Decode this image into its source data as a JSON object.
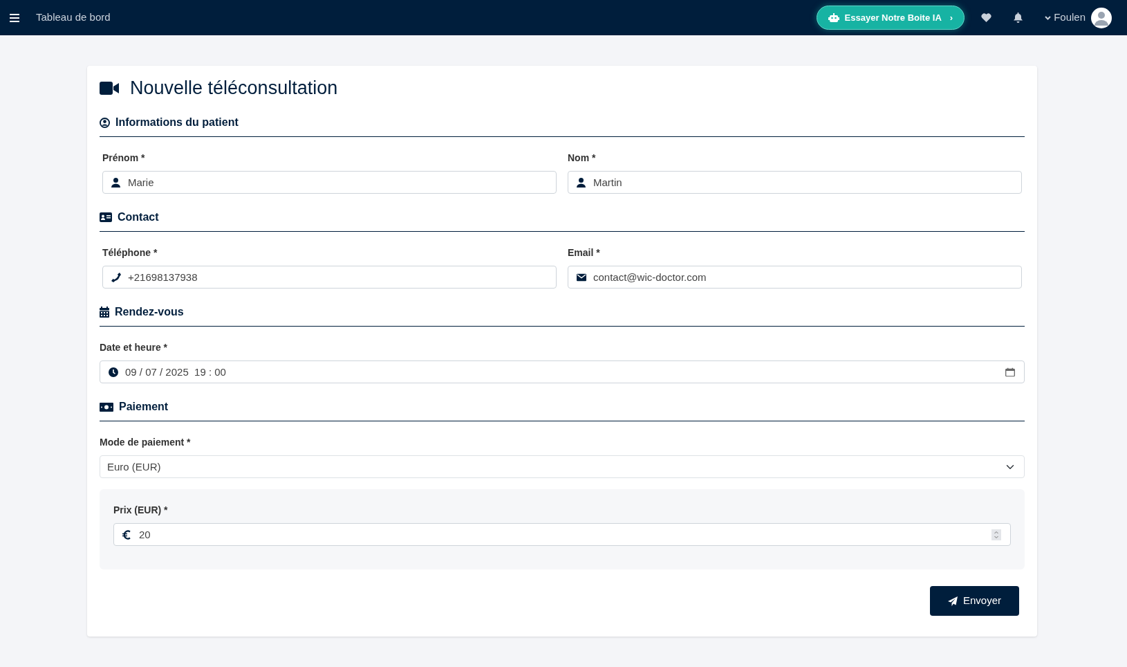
{
  "navbar": {
    "title": "Tableau de bord",
    "ai_button": {
      "label": "Essayer Notre Boite IA",
      "arrow": "›"
    },
    "user": {
      "name": "Foulen"
    }
  },
  "form": {
    "title": "Nouvelle téléconsultation",
    "sections": [
      {
        "title": "Informations du patient",
        "fields": [
          {
            "kind": "text",
            "label": "Prénom *",
            "value": "Marie"
          },
          {
            "kind": "text",
            "label": "Nom *",
            "value": "Martin"
          }
        ]
      },
      {
        "title": "Contact",
        "fields": [
          {
            "kind": "text",
            "label": "Téléphone *",
            "value": "+21698137938"
          },
          {
            "kind": "text",
            "label": "Email *",
            "value": "contact@wic-doctor.com"
          }
        ]
      },
      {
        "title": "Rendez-vous",
        "fields": [
          {
            "kind": "datetime",
            "label": "Date et heure *",
            "value": "09 / 07 / 2025  19 : 00"
          }
        ]
      },
      {
        "title": "Paiement",
        "fields": [
          {
            "kind": "select",
            "label": "Mode de paiement *",
            "value": "Euro (EUR)"
          },
          {
            "kind": "number",
            "label": "Prix (EUR) *",
            "value": "20"
          }
        ]
      }
    ],
    "submit": "Envoyer"
  }
}
